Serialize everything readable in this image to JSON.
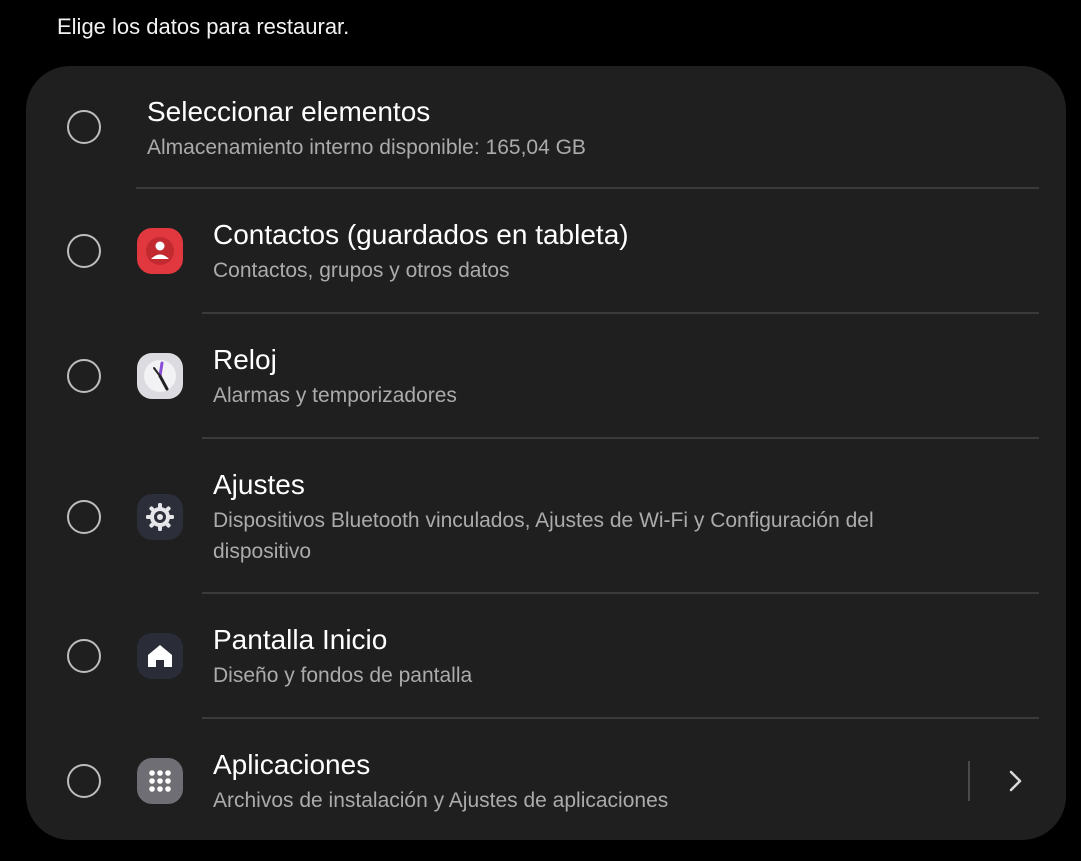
{
  "header": {
    "text": "Elige los datos para restaurar."
  },
  "select_all": {
    "title": "Seleccionar elementos",
    "subtitle": "Almacenamiento interno disponible: 165,04 GB"
  },
  "items": [
    {
      "title": "Contactos (guardados en tableta)",
      "subtitle": "Contactos, grupos y otros datos",
      "icon": "contacts-icon",
      "icon_color": "#e0383e"
    },
    {
      "title": "Reloj",
      "subtitle": "Alarmas y temporizadores",
      "icon": "clock-icon",
      "icon_color": "#dcdce0"
    },
    {
      "title": "Ajustes",
      "subtitle": "Dispositivos Bluetooth vinculados, Ajustes de Wi-Fi y Configuración del dispositivo",
      "icon": "settings-gear-icon",
      "icon_color": "#2c2f3a"
    },
    {
      "title": "Pantalla Inicio",
      "subtitle": "Diseño y fondos de pantalla",
      "icon": "home-icon",
      "icon_color": "#2a2d38"
    },
    {
      "title": "Aplicaciones",
      "subtitle": "Archivos de instalación y Ajustes de aplicaciones",
      "icon": "apps-grid-icon",
      "icon_color": "#6e6e74"
    }
  ],
  "colors": {
    "background": "#000000",
    "card": "#1f1f1f",
    "subtitle": "#ababab",
    "divider": "#3a3a3a"
  }
}
